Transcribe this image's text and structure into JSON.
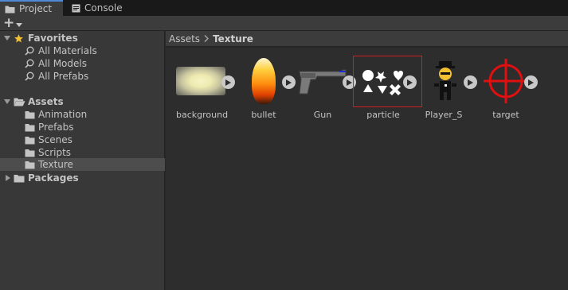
{
  "tabs": [
    {
      "label": "Project",
      "icon": "folder-icon",
      "active": true
    },
    {
      "label": "Console",
      "icon": "console-icon",
      "active": false
    }
  ],
  "toolbar": {
    "add_icon": "plus-icon",
    "dropdown_icon": "caret-down-icon"
  },
  "tree": {
    "favorites": {
      "label": "Favorites",
      "items": [
        {
          "label": "All Materials"
        },
        {
          "label": "All Models"
        },
        {
          "label": "All Prefabs"
        }
      ]
    },
    "assets": {
      "label": "Assets",
      "items": [
        {
          "label": "Animation"
        },
        {
          "label": "Prefabs"
        },
        {
          "label": "Scenes"
        },
        {
          "label": "Scripts"
        },
        {
          "label": "Texture",
          "selected": true
        }
      ]
    },
    "packages": {
      "label": "Packages"
    }
  },
  "breadcrumb": {
    "root": "Assets",
    "current": "Texture"
  },
  "grid": {
    "items": [
      {
        "label": "background",
        "icon": "background-texture-icon"
      },
      {
        "label": "bullet",
        "icon": "bullet-flame-icon"
      },
      {
        "label": "Gun",
        "icon": "gun-icon"
      },
      {
        "label": "particle",
        "icon": "particle-shapes-icon",
        "selected": true
      },
      {
        "label": "Player_S",
        "icon": "player-character-icon"
      },
      {
        "label": "target",
        "icon": "crosshair-target-icon"
      }
    ]
  },
  "colors": {
    "accent": "#4f8ad8",
    "selection_outline": "#d02020",
    "target_red": "#e01010"
  }
}
